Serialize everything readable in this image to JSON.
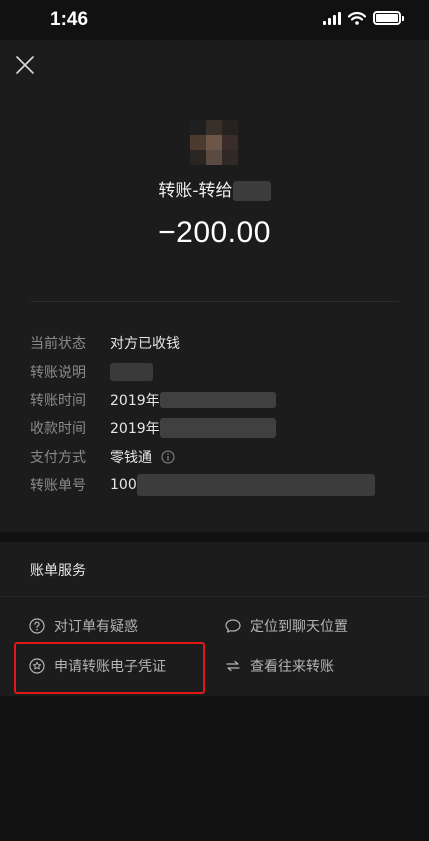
{
  "status_bar": {
    "time": "1:46"
  },
  "header": {
    "close_icon": "close-icon"
  },
  "transfer": {
    "title_prefix": "转账-转给",
    "amount": "−200.00"
  },
  "details": {
    "status_label": "当前状态",
    "status_value": "对方已收钱",
    "note_label": "转账说明",
    "transfer_time_label": "转账时间",
    "transfer_time_value": "2019年",
    "receive_time_label": "收款时间",
    "receive_time_value": "2019年",
    "payment_method_label": "支付方式",
    "payment_method_value": "零钱通",
    "order_no_label": "转账单号",
    "order_no_value": "100"
  },
  "services": {
    "title": "账单服务",
    "question": "对订单有疑惑",
    "locate_chat": "定位到聊天位置",
    "apply_certificate": "申请转账电子凭证",
    "view_history": "查看往来转账"
  },
  "colors": {
    "background": "#111111",
    "card": "#1c1c1c",
    "label": "#8a8a8a",
    "highlight_border": "#e01818"
  }
}
